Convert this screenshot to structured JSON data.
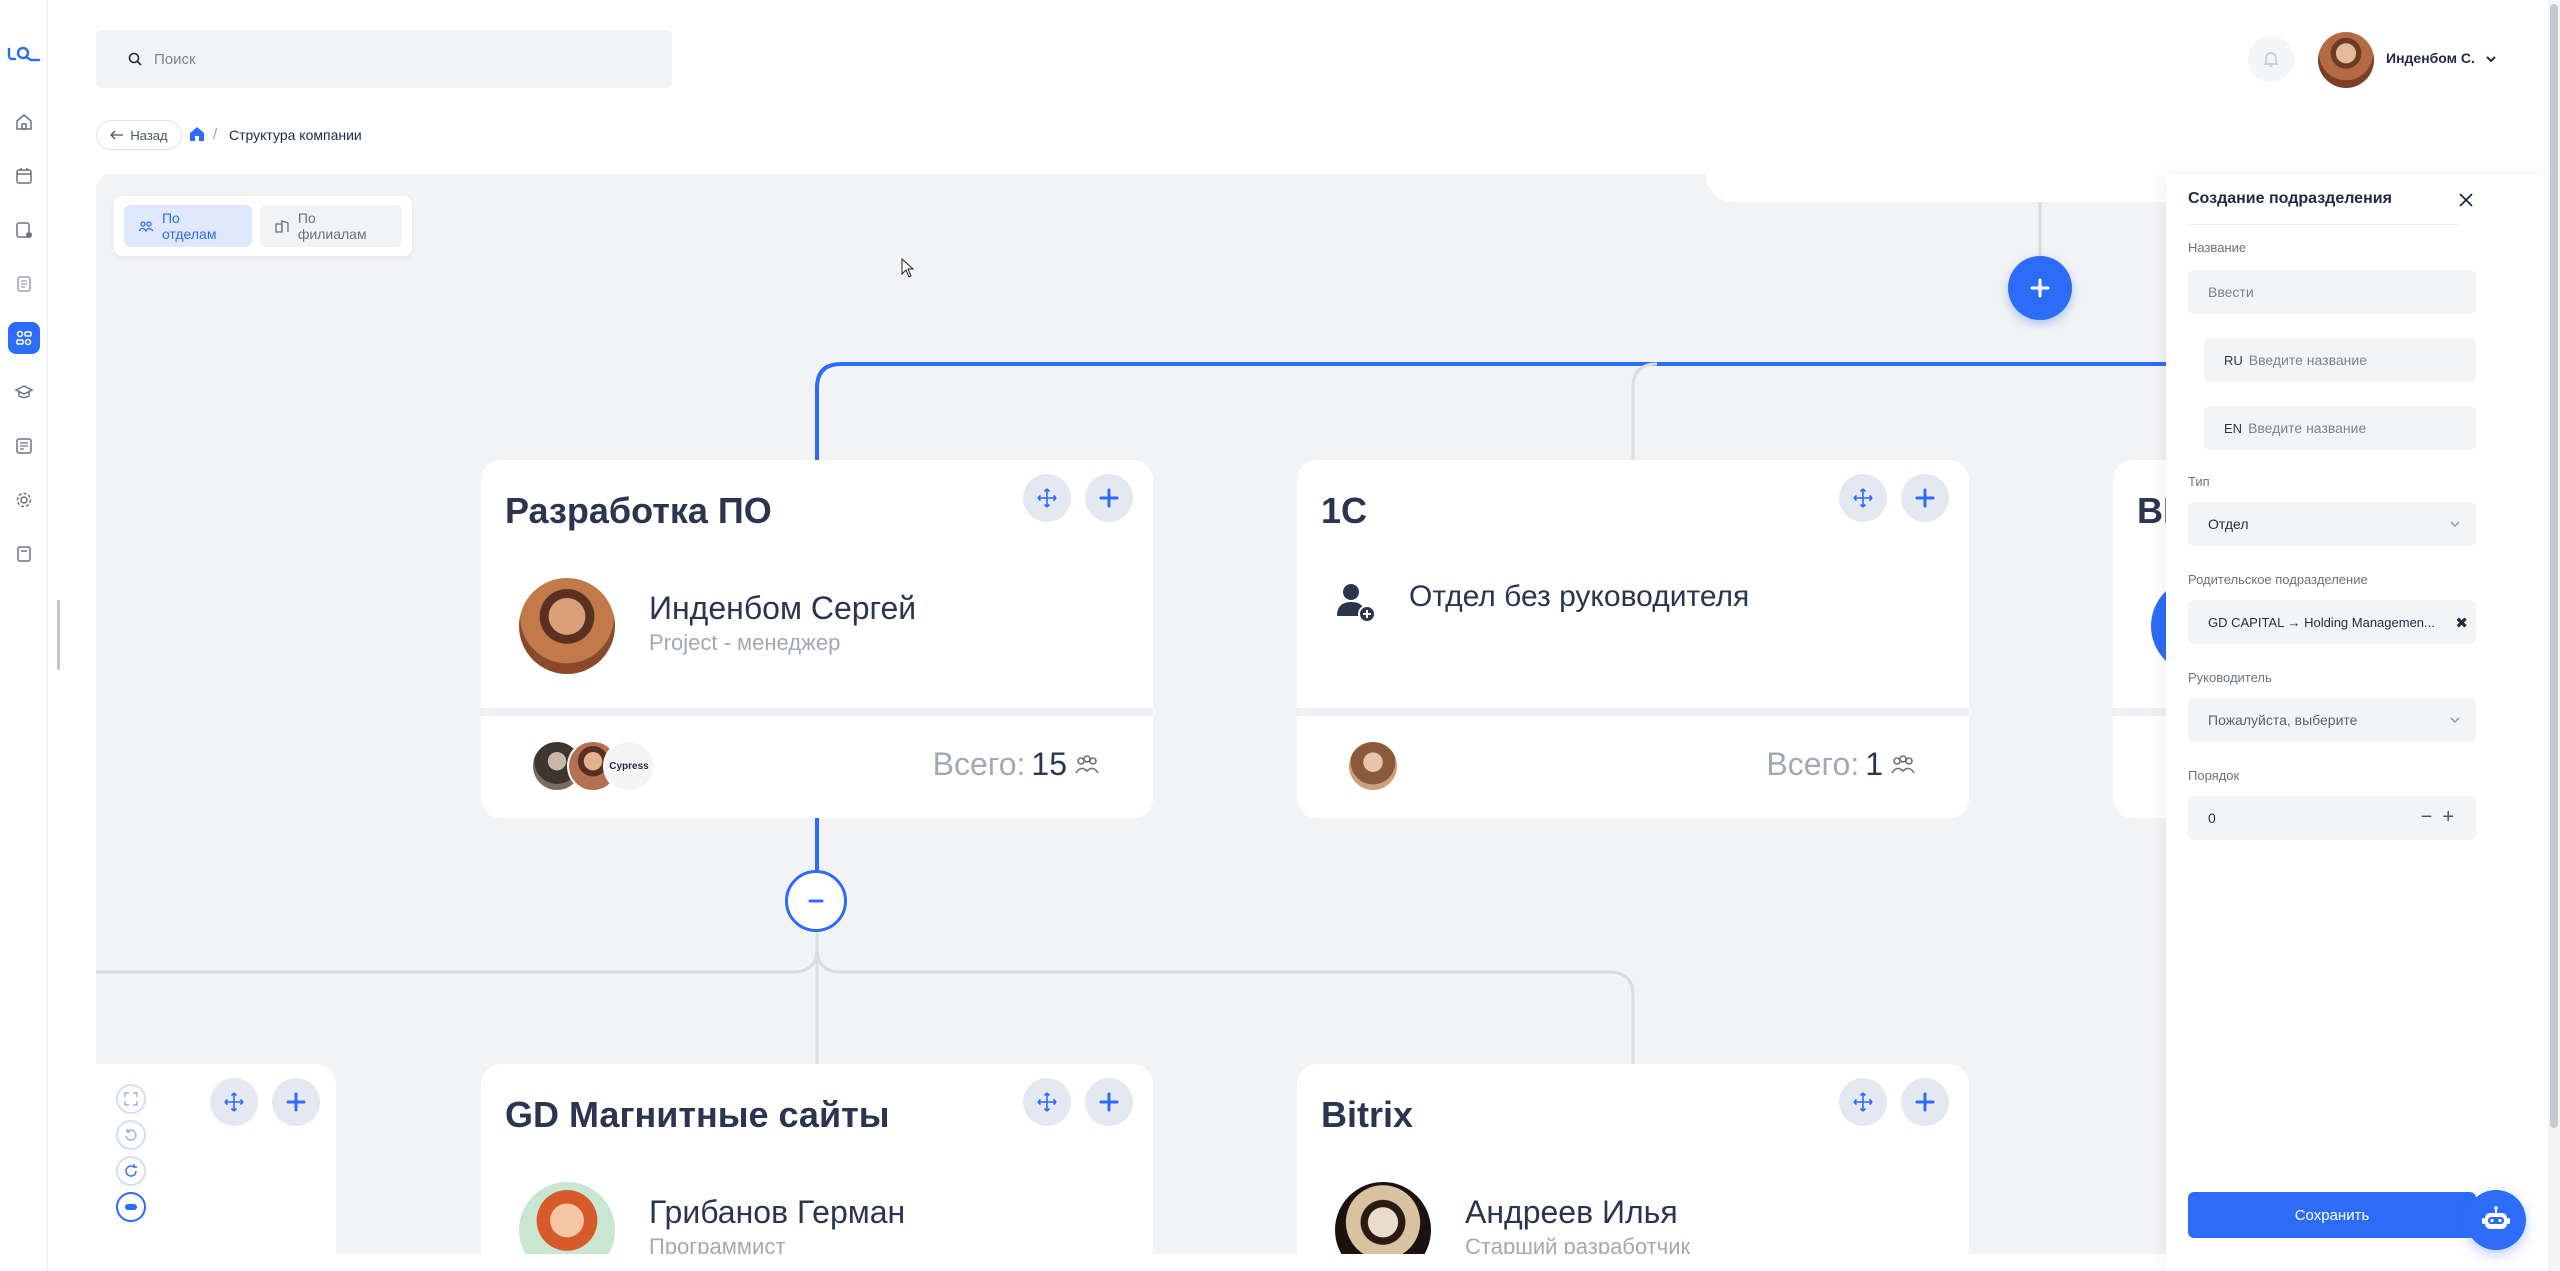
{
  "app": {
    "logo_text": "LQ"
  },
  "header": {
    "search_placeholder": "Поиск",
    "user_name": "Инденбом С."
  },
  "breadcrumb": {
    "back_label": "Назад",
    "separator": "/",
    "current": "Структура компании"
  },
  "view_toggle": {
    "by_departments": "По отделам",
    "by_branches": "По филиалам",
    "active": "По отделам"
  },
  "nav_icons": [
    "home-icon",
    "calendar-icon",
    "tasks-icon",
    "documents-icon",
    "structure-icon",
    "education-icon",
    "reports-icon",
    "settings-icon",
    "book-icon"
  ],
  "cards": [
    {
      "title": "Разработка ПО",
      "person": "Инденбом Сергей",
      "role": "Project - менеджер",
      "total_label": "Всего:",
      "total": "15",
      "stack_badge": "Cypress"
    },
    {
      "title": "1С",
      "person": "Отдел без руководителя",
      "role": "",
      "total_label": "Всего:",
      "total": "1"
    },
    {
      "title": "BI",
      "person": "",
      "role": ""
    },
    {
      "title": "GD Магнитные сайты",
      "person": "Грибанов Герман",
      "role": "Программист"
    },
    {
      "title": "Bitrix",
      "person": "Андреев Илья",
      "role": "Старший разработчик"
    }
  ],
  "panel": {
    "title": "Создание подразделения",
    "name_label": "Название",
    "name_placeholder": "Ввести",
    "ru_prefix": "RU",
    "ru_placeholder": "Введите название",
    "en_prefix": "EN",
    "en_placeholder": "Введите название",
    "type_label": "Тип",
    "type_value": "Отдел",
    "parent_label": "Родительское подразделение",
    "parent_value": "GD CAPITAL → Holding Managemen...",
    "manager_label": "Руководитель",
    "manager_placeholder": "Пожалуйста, выберите",
    "order_label": "Порядок",
    "order_value": "0",
    "save_label": "Сохранить"
  },
  "colors": {
    "accent": "#2d6cf6",
    "canvas": "#f2f3f5",
    "text": "#1f2a44",
    "muted": "#a3a9b4"
  }
}
